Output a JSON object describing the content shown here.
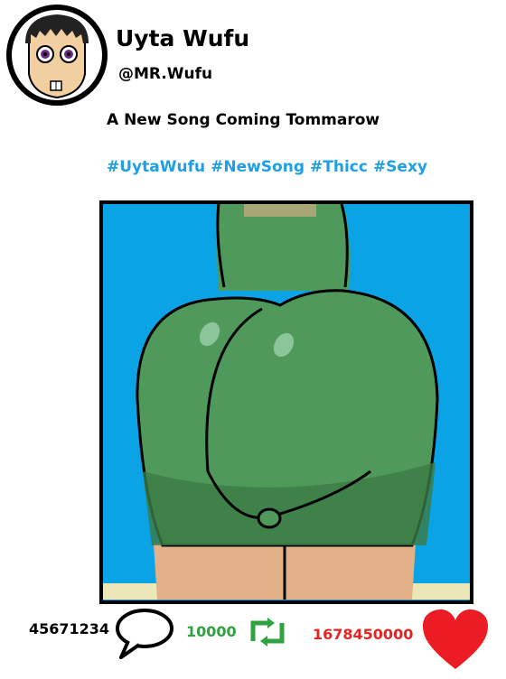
{
  "profile": {
    "display_name": "Uyta Wufu",
    "handle": "@MR.Wufu",
    "avatar_icon": "cartoon-face-avatar"
  },
  "post": {
    "text": "A New Song Coming Tommarow",
    "hashtags": [
      "#UytaWufu",
      "#NewSong",
      "#Thicc",
      "#Sexy"
    ]
  },
  "actions": {
    "reply_count": "45671234",
    "retweet_count": "10000",
    "like_count": "1678450000",
    "reply_icon": "speech-bubble-icon",
    "retweet_icon": "retweet-arrows-icon",
    "like_icon": "heart-icon"
  },
  "colors": {
    "hashtag": "#1e9fe6",
    "retweet": "#2fa13f",
    "like": "#e32424",
    "media_background": "#0aa3e6",
    "figure_green": "#4f9a5a"
  }
}
